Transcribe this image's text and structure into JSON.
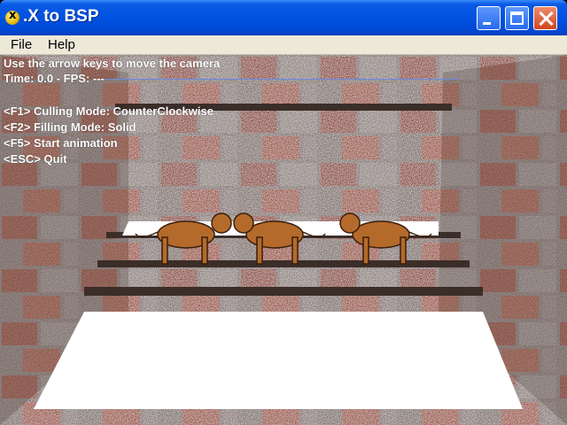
{
  "window": {
    "title": ".X to BSP"
  },
  "menu": {
    "file": "File",
    "help": "Help"
  },
  "overlay": {
    "instruction": "Use the arrow keys to move the camera",
    "time_fps": "Time: 0.0 - FPS: ---",
    "lines": [
      "<F1> Culling Mode: CounterClockwise",
      "<F2> Filling Mode: Solid",
      "<F5> Start animation",
      "<ESC> Quit"
    ]
  },
  "scene": {
    "tiger_count": 3,
    "colors": {
      "floor": "#ffffff",
      "stone": "#8a7670",
      "brick": "#8a3b2a",
      "tiger": "#b46a2a"
    }
  }
}
